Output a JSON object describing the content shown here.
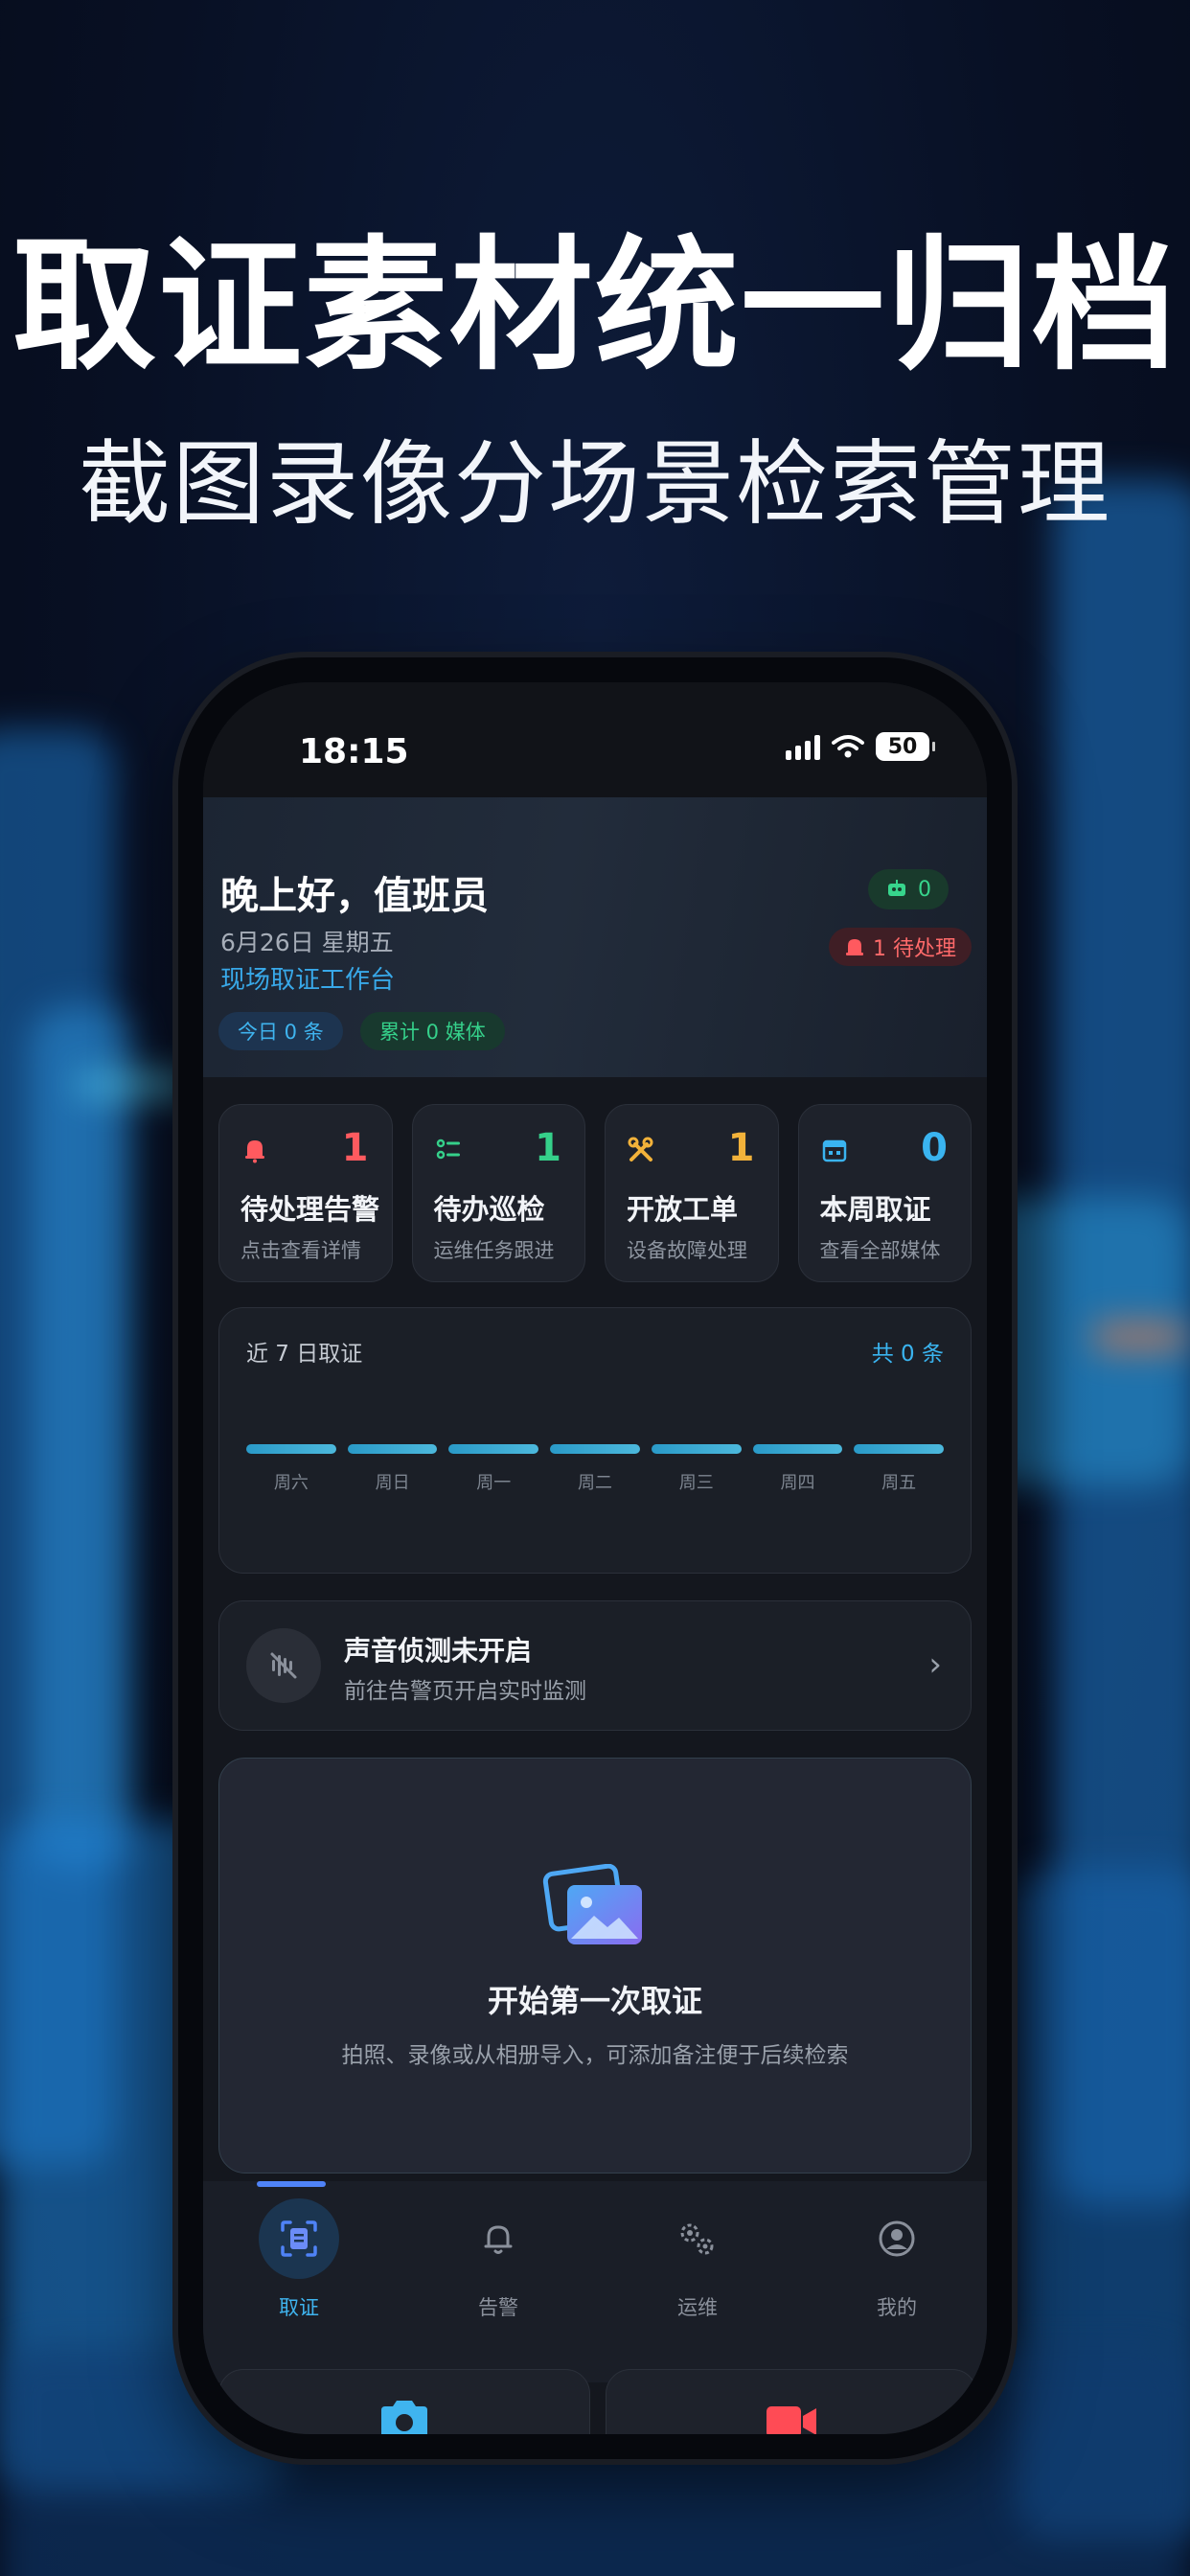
{
  "promo": {
    "headline": "取证素材统一归档",
    "subline": "截图录像分场景检索管理"
  },
  "status_bar": {
    "time": "18:15",
    "battery": "50"
  },
  "header": {
    "greeting": "晚上好，值班员",
    "date": "6月26日 星期五",
    "workbench": "现场取证工作台",
    "chip_today": "今日 0 条",
    "chip_total": "累计 0 媒体",
    "device_count": "0",
    "pending_badge": "1 待处理"
  },
  "cards": [
    {
      "num": "1",
      "title": "待处理告警",
      "sub": "点击查看详情",
      "icon": "bell-icon",
      "color": "#ff5a5f"
    },
    {
      "num": "1",
      "title": "待办巡检",
      "sub": "运维任务跟进",
      "icon": "checklist-icon",
      "color": "#35d08a"
    },
    {
      "num": "1",
      "title": "开放工单",
      "sub": "设备故障处理",
      "icon": "tools-icon",
      "color": "#f2b23a"
    },
    {
      "num": "0",
      "title": "本周取证",
      "sub": "查看全部媒体",
      "icon": "calendar-icon",
      "color": "#3ab4f0"
    }
  ],
  "chart_data": {
    "type": "bar",
    "title": "近 7 日取证",
    "total_label": "共 0 条",
    "categories": [
      "周六",
      "周日",
      "周一",
      "周二",
      "周三",
      "周四",
      "周五"
    ],
    "values": [
      0,
      0,
      0,
      0,
      0,
      0,
      0
    ]
  },
  "sound": {
    "title": "声音侦测未开启",
    "subtitle": "前往告警页开启实时监测"
  },
  "empty_state": {
    "title": "开始第一次取证",
    "subtitle": "拍照、录像或从相册导入，可添加备注便于后续检索"
  },
  "tabs": [
    {
      "label": "取证",
      "icon": "evidence-icon",
      "active": true
    },
    {
      "label": "告警",
      "icon": "bell-icon",
      "active": false
    },
    {
      "label": "运维",
      "icon": "gears-icon",
      "active": false
    },
    {
      "label": "我的",
      "icon": "user-icon",
      "active": false
    }
  ],
  "colors": {
    "accent_blue": "#3fb4ef",
    "green": "#35d08a",
    "red": "#ff5a5f",
    "amber": "#f2b23a",
    "camera": "#3fb4ef",
    "video": "#ff4b55"
  }
}
